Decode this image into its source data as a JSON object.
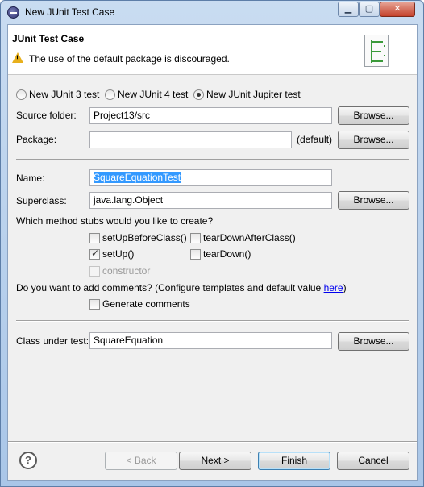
{
  "window": {
    "title": "New JUnit Test Case",
    "controls": {
      "minimize": "▁",
      "maximize": "▢",
      "close": "✕"
    }
  },
  "banner": {
    "title": "JUnit Test Case",
    "message": "The use of the default package is discouraged."
  },
  "test_version": {
    "options": [
      {
        "label": "New JUnit 3 test",
        "checked": false
      },
      {
        "label": "New JUnit 4 test",
        "checked": false
      },
      {
        "label": "New JUnit Jupiter test",
        "checked": true
      }
    ]
  },
  "source_folder": {
    "label": "Source folder:",
    "value": "Project13/src",
    "browse": "Browse..."
  },
  "package": {
    "label": "Package:",
    "value": "",
    "default_text": "(default)",
    "browse": "Browse..."
  },
  "name": {
    "label": "Name:",
    "value": "SquareEquationTest"
  },
  "superclass": {
    "label": "Superclass:",
    "value": "java.lang.Object",
    "browse": "Browse..."
  },
  "stubs": {
    "question": "Which method stubs would you like to create?",
    "items": [
      {
        "label": "setUpBeforeClass()",
        "checked": false,
        "enabled": true
      },
      {
        "label": "tearDownAfterClass()",
        "checked": false,
        "enabled": true
      },
      {
        "label": "setUp()",
        "checked": true,
        "enabled": true
      },
      {
        "label": "tearDown()",
        "checked": false,
        "enabled": true
      },
      {
        "label": "constructor",
        "checked": false,
        "enabled": false
      }
    ]
  },
  "comments": {
    "question_prefix": "Do you want to add comments? (Configure templates and default value ",
    "link": "here",
    "question_suffix": ")",
    "generate_label": "Generate comments"
  },
  "class_under_test": {
    "label": "Class under test:",
    "value": "SquareEquation",
    "browse": "Browse..."
  },
  "footer": {
    "help": "?",
    "back": "< Back",
    "next": "Next >",
    "finish": "Finish",
    "cancel": "Cancel"
  }
}
